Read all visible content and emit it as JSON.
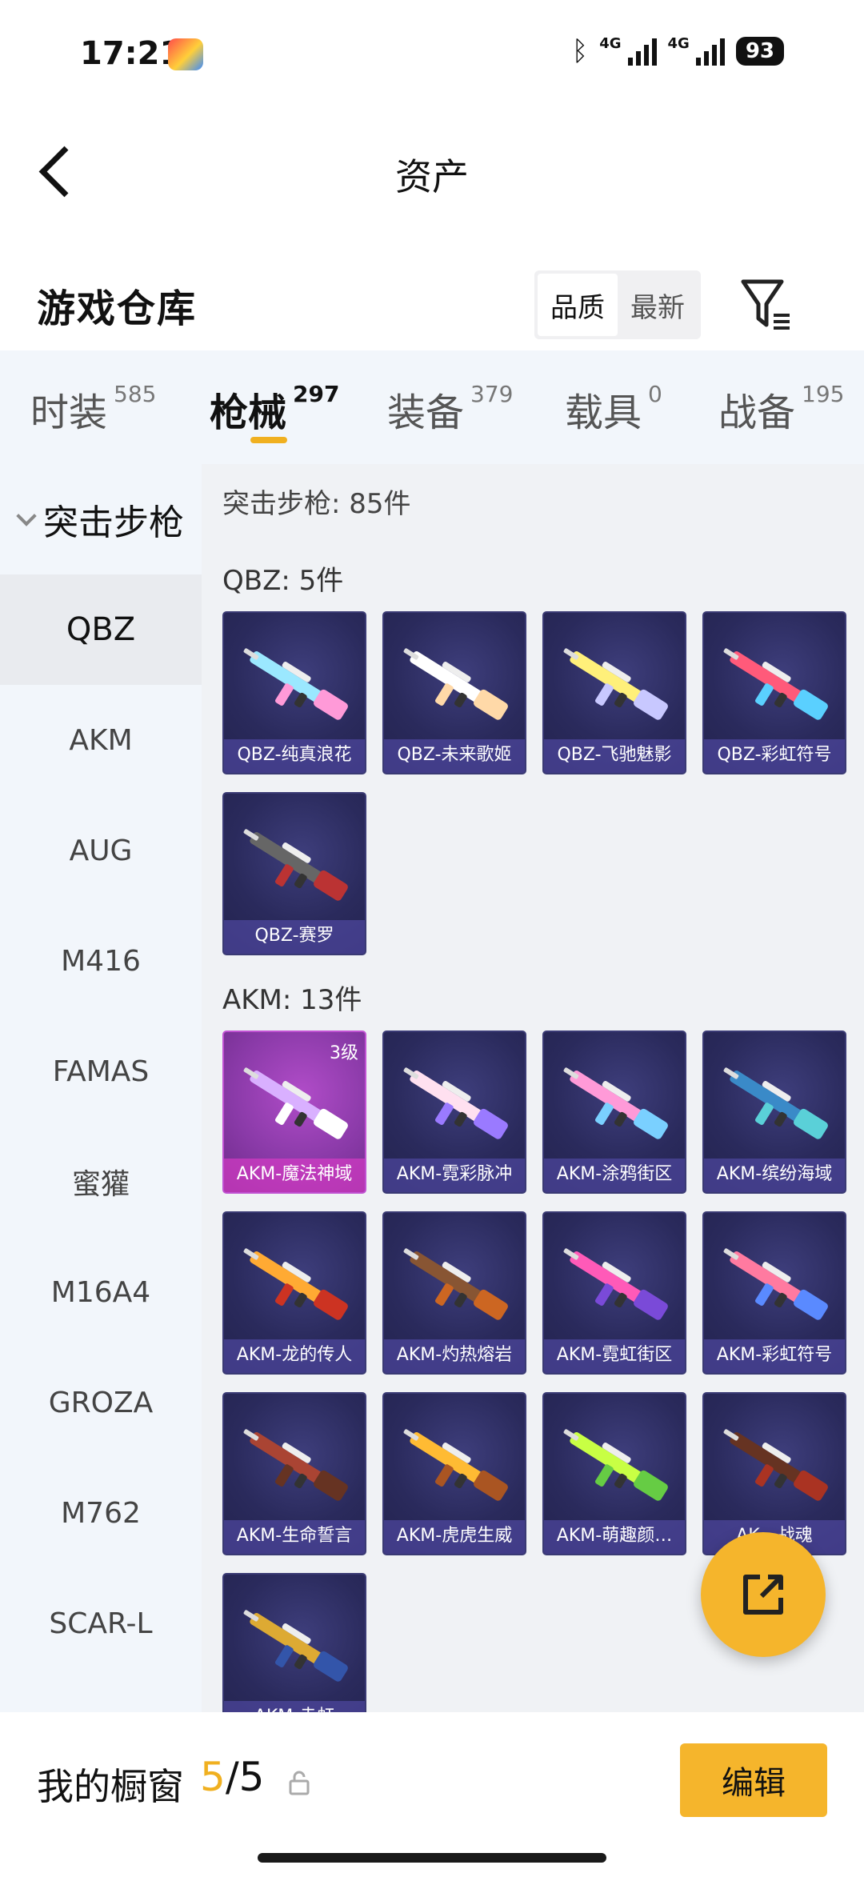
{
  "status_bar": {
    "time": "17:21",
    "network_1": "4G",
    "network_2": "4G",
    "battery": "93"
  },
  "header": {
    "title": "资产",
    "back_icon": "back-icon"
  },
  "warehouse": {
    "title": "游戏仓库",
    "sort_options": [
      "品质",
      "最新"
    ],
    "sort_selected": "品质",
    "filter_icon": "filter-icon"
  },
  "category_tabs": [
    {
      "label": "时装",
      "count": "585",
      "active": false
    },
    {
      "label": "枪械",
      "count": "297",
      "active": true
    },
    {
      "label": "装备",
      "count": "379",
      "active": false
    },
    {
      "label": "载具",
      "count": "0",
      "active": false
    },
    {
      "label": "战备",
      "count": "195",
      "active": false
    }
  ],
  "sidebar": {
    "header": "突击步枪",
    "items": [
      "QBZ",
      "AKM",
      "AUG",
      "M416",
      "FAMAS",
      "蜜獾",
      "M16A4",
      "GROZA",
      "M762",
      "SCAR-L"
    ],
    "active": "QBZ"
  },
  "content": {
    "total": "突击步枪: 85件",
    "groups": [
      {
        "title": "QBZ: 5件",
        "items": [
          {
            "name": "QBZ-纯真浪花",
            "level": ""
          },
          {
            "name": "QBZ-未来歌姬",
            "level": ""
          },
          {
            "name": "QBZ-飞驰魅影",
            "level": ""
          },
          {
            "name": "QBZ-彩虹符号",
            "level": ""
          },
          {
            "name": "QBZ-赛罗",
            "level": ""
          }
        ]
      },
      {
        "title": "AKM: 13件",
        "items": [
          {
            "name": "AKM-魔法神域",
            "level": "3级"
          },
          {
            "name": "AKM-霓彩脉冲",
            "level": ""
          },
          {
            "name": "AKM-涂鸦街区",
            "level": ""
          },
          {
            "name": "AKM-缤纷海域",
            "level": ""
          },
          {
            "name": "AKM-龙的传人",
            "level": ""
          },
          {
            "name": "AKM-灼热熔岩",
            "level": ""
          },
          {
            "name": "AKM-霓虹街区",
            "level": ""
          },
          {
            "name": "AKM-彩虹符号",
            "level": ""
          },
          {
            "name": "AKM-生命誓言",
            "level": ""
          },
          {
            "name": "AKM-虎虎生威",
            "level": ""
          },
          {
            "name": "AKM-萌趣颜…",
            "level": ""
          },
          {
            "name": "AK…战魂",
            "level": ""
          },
          {
            "name": "AKM-赤虹",
            "level": ""
          }
        ]
      }
    ]
  },
  "share_button_icon": "share-icon",
  "bottom_bar": {
    "label": "我的橱窗",
    "current": "5",
    "total": "/5",
    "lock_icon": "lock-icon",
    "edit_label": "编辑"
  },
  "colors": {
    "accent": "#f5b52c",
    "card_bg": "#2a2a5c",
    "card_highlight": "#b04cc8"
  }
}
